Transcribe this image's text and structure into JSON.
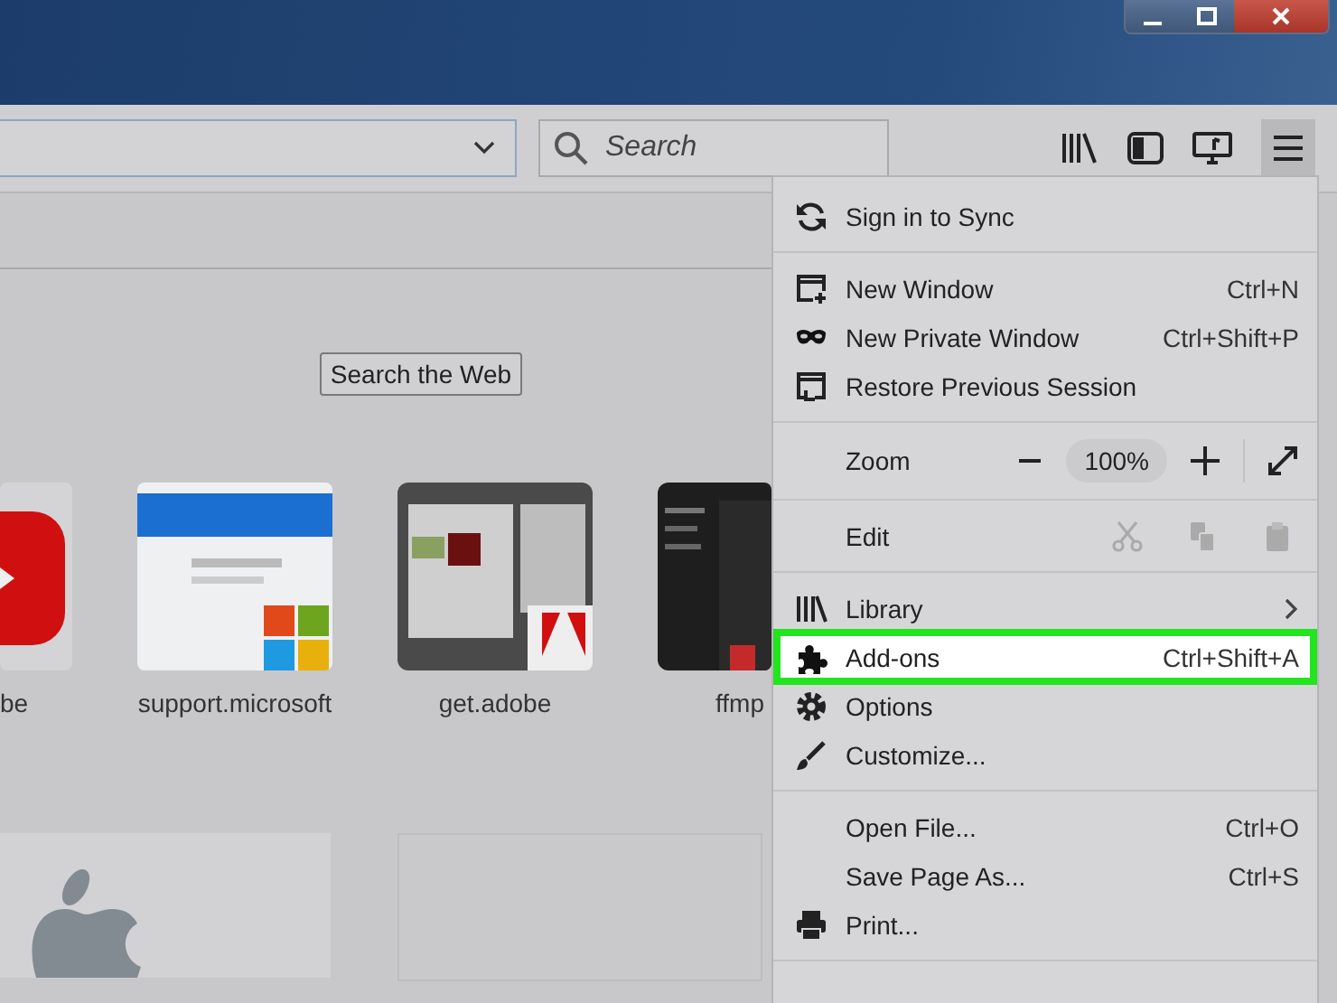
{
  "toolbar": {
    "search": {
      "placeholder": "Search"
    },
    "menu_button": {
      "pressed": true
    }
  },
  "page": {
    "search_button": "Search the Web",
    "top_sites": [
      {
        "label": "be"
      },
      {
        "label": "support.microsoft"
      },
      {
        "label": "get.adobe"
      },
      {
        "label": "ffmp"
      }
    ]
  },
  "menu": {
    "items": [
      {
        "kind": "item",
        "label": "Sign in to Sync",
        "highlighted": false
      },
      {
        "kind": "separator"
      },
      {
        "kind": "item",
        "label": "New Window",
        "shortcut": "Ctrl+N",
        "highlighted": false
      },
      {
        "kind": "item",
        "label": "New Private Window",
        "shortcut": "Ctrl+Shift+P",
        "highlighted": false
      },
      {
        "kind": "item",
        "label": "Restore Previous Session",
        "highlighted": false
      },
      {
        "kind": "separator"
      },
      {
        "kind": "zoom",
        "label": "Zoom",
        "value": "100%"
      },
      {
        "kind": "separator"
      },
      {
        "kind": "edit",
        "label": "Edit"
      },
      {
        "kind": "separator"
      },
      {
        "kind": "item",
        "label": "Library",
        "submenu": true,
        "highlighted": false
      },
      {
        "kind": "item",
        "label": "Add-ons",
        "shortcut": "Ctrl+Shift+A",
        "highlighted": true
      },
      {
        "kind": "item",
        "label": "Options",
        "highlighted": false
      },
      {
        "kind": "item",
        "label": "Customize...",
        "highlighted": false
      },
      {
        "kind": "separator"
      },
      {
        "kind": "item",
        "label": "Open File...",
        "shortcut": "Ctrl+O",
        "highlighted": false
      },
      {
        "kind": "item",
        "label": "Save Page As...",
        "shortcut": "Ctrl+S",
        "highlighted": false
      },
      {
        "kind": "item",
        "label": "Print...",
        "highlighted": false
      },
      {
        "kind": "separator"
      }
    ]
  }
}
